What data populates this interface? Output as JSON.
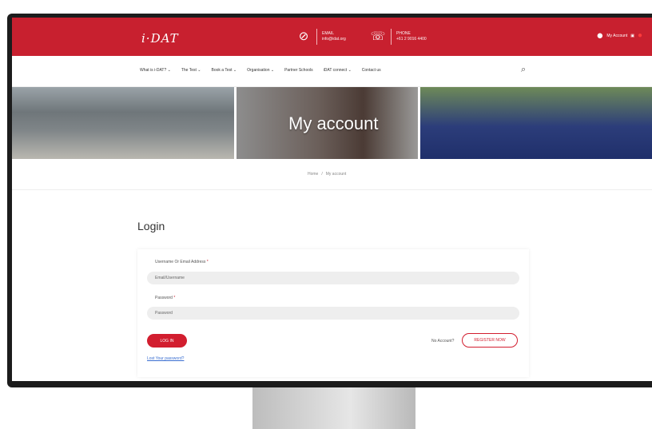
{
  "header": {
    "logo": "i·DAT",
    "email": {
      "title": "EMAIL",
      "value": "info@idat.org",
      "icon": "email-icon"
    },
    "phone": {
      "title": "PHONE",
      "value": "+61 2 9016 4400",
      "icon": "phone-icon"
    },
    "account_label": "My Account",
    "account_icon": "user-icon"
  },
  "nav": {
    "items": [
      "What is i-DAT? ⌄",
      "The Test ⌄",
      "Book a Test ⌄",
      "Organisation ⌄",
      "Partner Schools",
      "iDAT connect ⌄",
      "Contact us"
    ],
    "search_icon": "search-icon"
  },
  "banner": {
    "title": "My account"
  },
  "breadcrumb": {
    "home": "Home",
    "separator": "/",
    "current": "My account"
  },
  "login": {
    "title": "Login",
    "username_label": "Username Or Email Address",
    "username_placeholder": "Email/Username",
    "password_label": "Password",
    "password_placeholder": "Password",
    "required_mark": "*",
    "login_button": "LOG IN",
    "lost_password": "Lost Your password?",
    "no_account": "No Account?",
    "register_button": "REGISTER NOW"
  },
  "colors": {
    "brand": "#c8202f",
    "link": "#3b6fd1"
  }
}
